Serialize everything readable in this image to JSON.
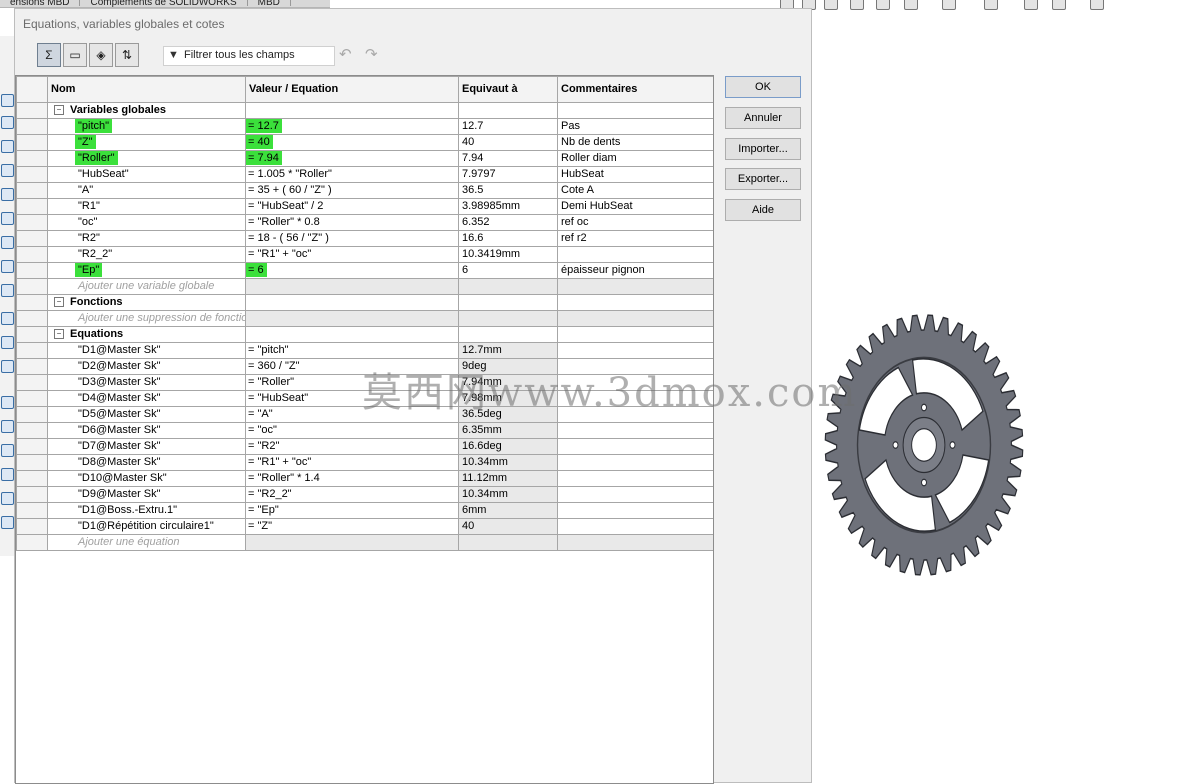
{
  "top_tabs": [
    "ensions MBD",
    "Compléments de SOLIDWORKS",
    "MBD"
  ],
  "dialog": {
    "title": "Equations, variables globales et cotes",
    "filter_label": "Filtrer tous les champs",
    "buttons": {
      "ok": "OK",
      "cancel": "Annuler",
      "import": "Importer...",
      "export": "Exporter...",
      "help": "Aide"
    }
  },
  "table": {
    "headers": {
      "name": "Nom",
      "value": "Valeur / Equation",
      "equiv": "Equivaut à",
      "comments": "Commentaires"
    },
    "sections": {
      "globals": "Variables globales",
      "functions": "Fonctions",
      "equations": "Equations"
    },
    "add_global": "Ajouter une variable globale",
    "add_function": "Ajouter une suppression de fonction",
    "add_equation": "Ajouter une équation",
    "globals": [
      {
        "name": "\"pitch\"",
        "value": "= 12.7",
        "equiv": "12.7",
        "comment": "Pas",
        "hl_name": true,
        "hl_value": true
      },
      {
        "name": "\"Z\"",
        "value": "= 40",
        "equiv": "40",
        "comment": "Nb de dents",
        "hl_name": true,
        "hl_value": true
      },
      {
        "name": "\"Roller\"",
        "value": "= 7.94",
        "equiv": "7.94",
        "comment": "Roller diam",
        "hl_name": true,
        "hl_value": true
      },
      {
        "name": "\"HubSeat\"",
        "value": "= 1.005 * \"Roller\"",
        "equiv": "7.9797",
        "comment": "HubSeat"
      },
      {
        "name": "\"A\"",
        "value": "= 35 + ( 60 / \"Z\" )",
        "equiv": "36.5",
        "comment": "Cote A"
      },
      {
        "name": "\"R1\"",
        "value": "= \"HubSeat\" / 2",
        "equiv": "3.98985mm",
        "comment": "Demi HubSeat"
      },
      {
        "name": "\"oc\"",
        "value": "= \"Roller\" * 0.8",
        "equiv": "6.352",
        "comment": "ref oc"
      },
      {
        "name": "\"R2\"",
        "value": "= 18 - ( 56 / \"Z\" )",
        "equiv": "16.6",
        "comment": "ref r2"
      },
      {
        "name": "\"R2_2\"",
        "value": "= \"R1\" + \"oc\"",
        "equiv": "10.3419mm",
        "comment": ""
      },
      {
        "name": "\"Ep\"",
        "value": "= 6",
        "equiv": "6",
        "comment": "épaisseur pignon",
        "hl_name": true,
        "hl_value": true
      }
    ],
    "equations": [
      {
        "name": "\"D1@Master Sk\"",
        "value": "= \"pitch\"",
        "equiv": "12.7mm"
      },
      {
        "name": "\"D2@Master Sk\"",
        "value": "= 360 / \"Z\"",
        "equiv": "9deg"
      },
      {
        "name": "\"D3@Master Sk\"",
        "value": "= \"Roller\"",
        "equiv": "7.94mm"
      },
      {
        "name": "\"D4@Master Sk\"",
        "value": "= \"HubSeat\"",
        "equiv": "7.98mm"
      },
      {
        "name": "\"D5@Master Sk\"",
        "value": "= \"A\"",
        "equiv": "36.5deg"
      },
      {
        "name": "\"D6@Master Sk\"",
        "value": "= \"oc\"",
        "equiv": "6.35mm"
      },
      {
        "name": "\"D7@Master Sk\"",
        "value": "= \"R2\"",
        "equiv": "16.6deg"
      },
      {
        "name": "\"D8@Master Sk\"",
        "value": "= \"R1\" + \"oc\"",
        "equiv": "10.34mm"
      },
      {
        "name": "\"D10@Master Sk\"",
        "value": "= \"Roller\" * 1.4",
        "equiv": "11.12mm"
      },
      {
        "name": "\"D9@Master Sk\"",
        "value": "= \"R2_2\"",
        "equiv": "10.34mm"
      },
      {
        "name": "\"D1@Boss.-Extru.1\"",
        "value": "= \"Ep\"",
        "equiv": "6mm"
      },
      {
        "name": "\"D1@Répétition circulaire1\"",
        "value": "= \"Z\"",
        "equiv": "40"
      }
    ]
  },
  "watermark": "莫西网www.3dmox.com",
  "gear": {
    "teeth": 40,
    "color": "#6e717a"
  }
}
